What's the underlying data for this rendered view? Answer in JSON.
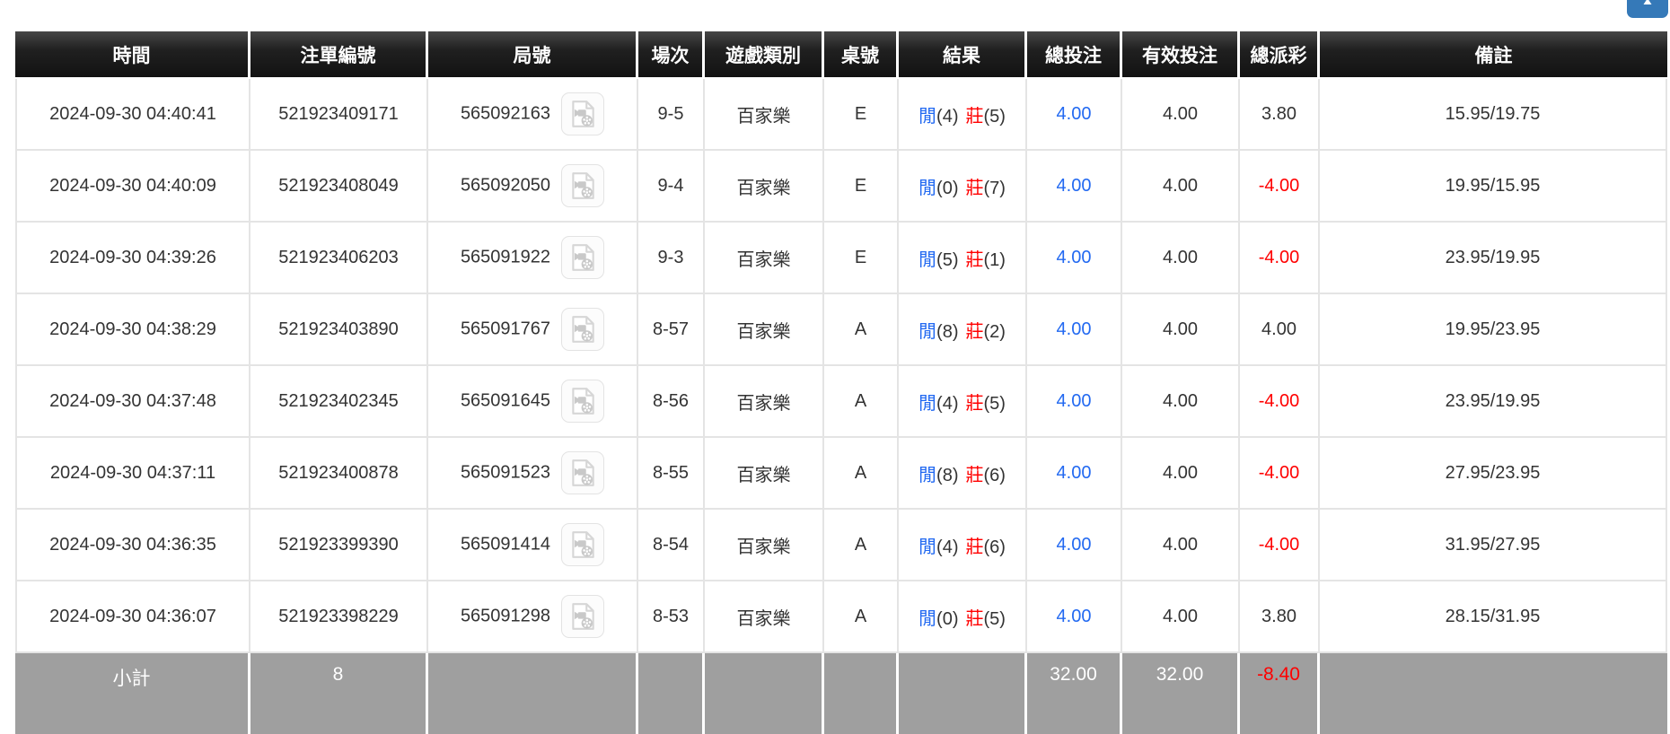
{
  "colors": {
    "accent_blue": "#2269f1",
    "negative_red": "#ff0000",
    "header_bg": "#1a1a1a",
    "subtotal_bg": "#9f9f9f",
    "top_button_blue": "#3579b8",
    "border_grey": "#e4e4e4"
  },
  "scroll_top_button": {
    "icon": "up-arrow"
  },
  "table": {
    "columns": [
      {
        "id": "time",
        "label": "時間"
      },
      {
        "id": "bet_id",
        "label": "注單編號"
      },
      {
        "id": "round_no",
        "label": "局號"
      },
      {
        "id": "session",
        "label": "場次"
      },
      {
        "id": "game_type",
        "label": "遊戲類別"
      },
      {
        "id": "table_no",
        "label": "桌號"
      },
      {
        "id": "result",
        "label": "結果"
      },
      {
        "id": "total_bet",
        "label": "總投注"
      },
      {
        "id": "valid_bet",
        "label": "有效投注"
      },
      {
        "id": "payout",
        "label": "總派彩"
      },
      {
        "id": "remark",
        "label": "備註"
      }
    ],
    "rows": [
      {
        "time": "2024-09-30 04:40:41",
        "bet_id": "521923409171",
        "round_no": "565092163",
        "session": "9-5",
        "game_type": "百家樂",
        "table_no": "E",
        "result": {
          "player_label": "閒",
          "player_points": "(4)",
          "banker_label": "莊",
          "banker_points": "(5)"
        },
        "total_bet": "4.00",
        "valid_bet": "4.00",
        "payout": "3.80",
        "remark": "15.95/19.75"
      },
      {
        "time": "2024-09-30 04:40:09",
        "bet_id": "521923408049",
        "round_no": "565092050",
        "session": "9-4",
        "game_type": "百家樂",
        "table_no": "E",
        "result": {
          "player_label": "閒",
          "player_points": "(0)",
          "banker_label": "莊",
          "banker_points": "(7)"
        },
        "total_bet": "4.00",
        "valid_bet": "4.00",
        "payout": "-4.00",
        "remark": "19.95/15.95"
      },
      {
        "time": "2024-09-30 04:39:26",
        "bet_id": "521923406203",
        "round_no": "565091922",
        "session": "9-3",
        "game_type": "百家樂",
        "table_no": "E",
        "result": {
          "player_label": "閒",
          "player_points": "(5)",
          "banker_label": "莊",
          "banker_points": "(1)"
        },
        "total_bet": "4.00",
        "valid_bet": "4.00",
        "payout": "-4.00",
        "remark": "23.95/19.95"
      },
      {
        "time": "2024-09-30 04:38:29",
        "bet_id": "521923403890",
        "round_no": "565091767",
        "session": "8-57",
        "game_type": "百家樂",
        "table_no": "A",
        "result": {
          "player_label": "閒",
          "player_points": "(8)",
          "banker_label": "莊",
          "banker_points": "(2)"
        },
        "total_bet": "4.00",
        "valid_bet": "4.00",
        "payout": "4.00",
        "remark": "19.95/23.95"
      },
      {
        "time": "2024-09-30 04:37:48",
        "bet_id": "521923402345",
        "round_no": "565091645",
        "session": "8-56",
        "game_type": "百家樂",
        "table_no": "A",
        "result": {
          "player_label": "閒",
          "player_points": "(4)",
          "banker_label": "莊",
          "banker_points": "(5)"
        },
        "total_bet": "4.00",
        "valid_bet": "4.00",
        "payout": "-4.00",
        "remark": "23.95/19.95"
      },
      {
        "time": "2024-09-30 04:37:11",
        "bet_id": "521923400878",
        "round_no": "565091523",
        "session": "8-55",
        "game_type": "百家樂",
        "table_no": "A",
        "result": {
          "player_label": "閒",
          "player_points": "(8)",
          "banker_label": "莊",
          "banker_points": "(6)"
        },
        "total_bet": "4.00",
        "valid_bet": "4.00",
        "payout": "-4.00",
        "remark": "27.95/23.95"
      },
      {
        "time": "2024-09-30 04:36:35",
        "bet_id": "521923399390",
        "round_no": "565091414",
        "session": "8-54",
        "game_type": "百家樂",
        "table_no": "A",
        "result": {
          "player_label": "閒",
          "player_points": "(4)",
          "banker_label": "莊",
          "banker_points": "(6)"
        },
        "total_bet": "4.00",
        "valid_bet": "4.00",
        "payout": "-4.00",
        "remark": "31.95/27.95"
      },
      {
        "time": "2024-09-30 04:36:07",
        "bet_id": "521923398229",
        "round_no": "565091298",
        "session": "8-53",
        "game_type": "百家樂",
        "table_no": "A",
        "result": {
          "player_label": "閒",
          "player_points": "(0)",
          "banker_label": "莊",
          "banker_points": "(5)"
        },
        "total_bet": "4.00",
        "valid_bet": "4.00",
        "payout": "3.80",
        "remark": "28.15/31.95"
      }
    ],
    "subtotal": {
      "label": "小計",
      "count": "8",
      "total_bet": "32.00",
      "valid_bet": "32.00",
      "payout": "-8.40"
    }
  }
}
